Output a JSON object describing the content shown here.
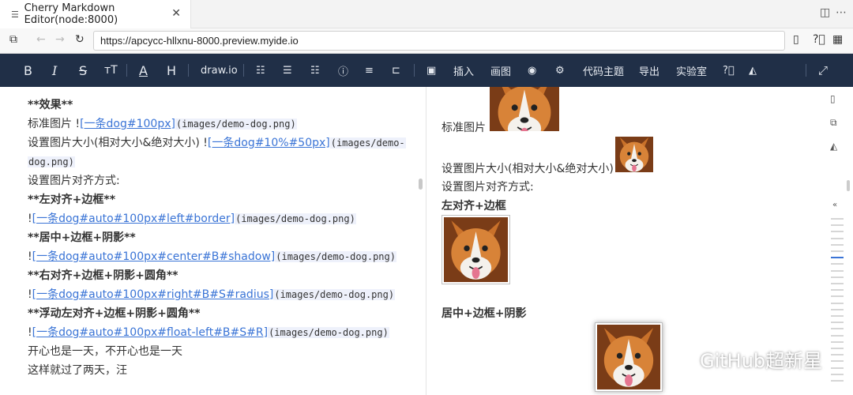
{
  "tab": {
    "title": "Cherry Markdown Editor(node:8000)",
    "icon": "document-icon",
    "close": "✕"
  },
  "address": {
    "url": "https://apcycc-hllxnu-8000.preview.myide.io"
  },
  "toolbar": {
    "bold": "B",
    "italic": "I",
    "strike": "S",
    "size": "тT",
    "color": "A",
    "header": "H",
    "drawio": "draw.io",
    "insert": "插入",
    "draw": "画图",
    "code_theme": "代码主题",
    "export": "导出",
    "lab": "实验室"
  },
  "editor": {
    "lines": {
      "l1": "**效果**",
      "l2_text": "标准图片  !",
      "l2_link": "[一条dog#100px]",
      "l2_code": "(images/demo-dog.png)",
      "l3_text": "设置图片大小(相对大小&绝对大小)  !",
      "l3_link": "[一条dog#10%#50px]",
      "l3_code": "(images/demo-",
      "l4_code": "dog.png)",
      "l5": "设置图片对齐方式:",
      "l6": "**左对齐+边框**",
      "l7_pre": "!",
      "l7_link": "[一条dog#auto#100px#left#border]",
      "l7_code": "(images/demo-dog.png)",
      "l8": "**居中+边框+阴影**",
      "l9_pre": "!",
      "l9_link": "[一条dog#auto#100px#center#B#shadow]",
      "l9_code": "(images/demo-dog.png)",
      "l10": "**右对齐+边框+阴影+圆角**",
      "l11_pre": "!",
      "l11_link": "[一条dog#auto#100px#right#B#S#radius]",
      "l11_code": "(images/demo-dog.png)",
      "l12": "**浮动左对齐+边框+阴影+圆角**",
      "l13_pre": "!",
      "l13_link": "[一条dog#auto#100px#float-left#B#S#R]",
      "l13_code": "(images/demo-dog.png)",
      "l14": "开心也是一天，不开心也是一天",
      "l15": "这样就过了两天，汪"
    }
  },
  "preview": {
    "standard_label": "标准图片",
    "size_label": "设置图片大小(相对大小&绝对大小)",
    "align_label": "设置图片对齐方式:",
    "left_border": "左对齐+边框",
    "center_border_shadow": "居中+边框+阴影"
  },
  "watermark": {
    "text": "GitHub超新星"
  },
  "colors": {
    "toolbar_bg": "#202f47",
    "link": "#3a74d6",
    "code_bg": "#eef1fb",
    "toc_active": "#3a74d6"
  }
}
